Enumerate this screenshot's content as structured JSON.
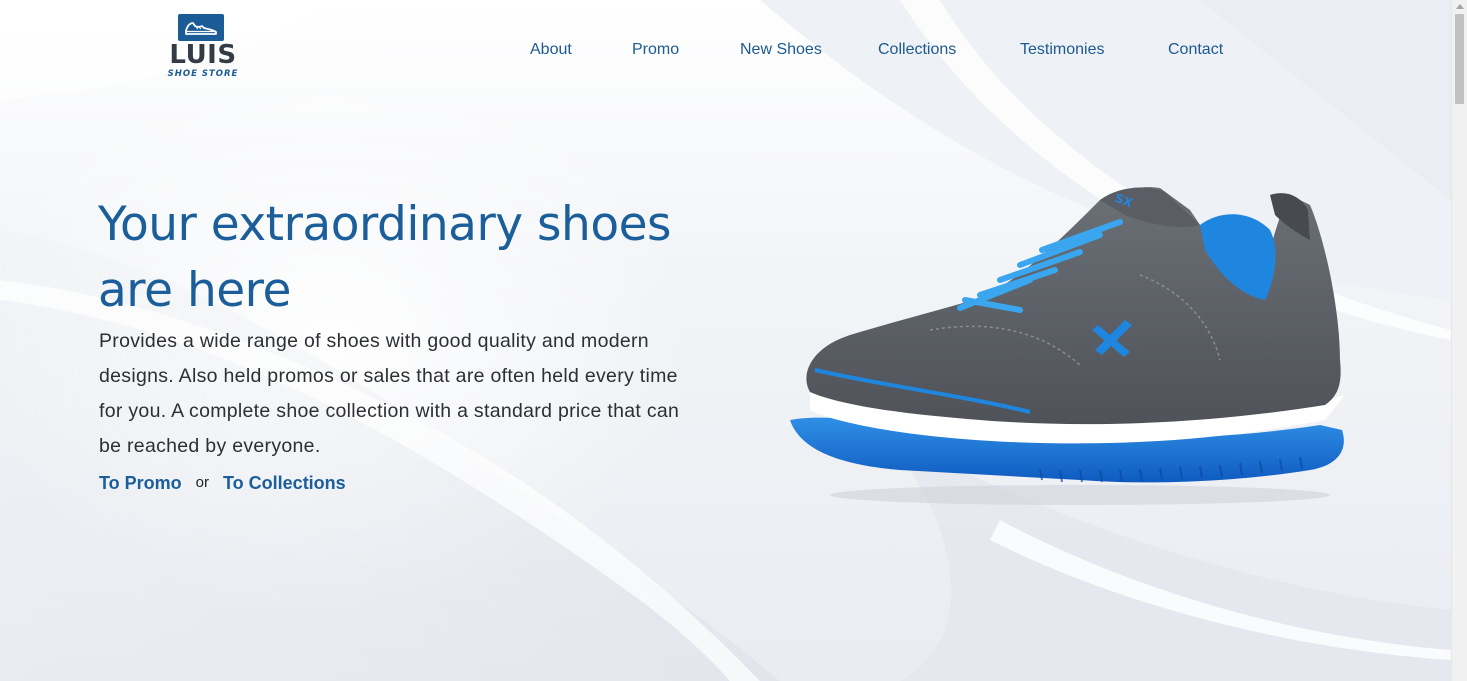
{
  "logo": {
    "name": "LUIS",
    "tagline": "SHOE STORE"
  },
  "nav": {
    "items": [
      {
        "label": "About"
      },
      {
        "label": "Promo"
      },
      {
        "label": "New Shoes"
      },
      {
        "label": "Collections"
      },
      {
        "label": "Testimonies"
      },
      {
        "label": "Contact"
      }
    ]
  },
  "hero": {
    "title": "Your extraordinary shoes are here",
    "description": "Provides a wide range of shoes with good quality and modern designs. Also held promos or sales that are often held every time for you. A complete shoe collection with a standard price that can be reached by everyone.",
    "cta_promo": "To Promo",
    "cta_separator": "or",
    "cta_collections": "To Collections"
  },
  "colors": {
    "brand": "#1b5e9a",
    "shoe_body": "#5e6268",
    "shoe_accent": "#1f86e0",
    "background": "#f3f5f8"
  },
  "icons": {
    "logo_icon": "shoe-icon",
    "hero_image": "sneaker-image"
  }
}
